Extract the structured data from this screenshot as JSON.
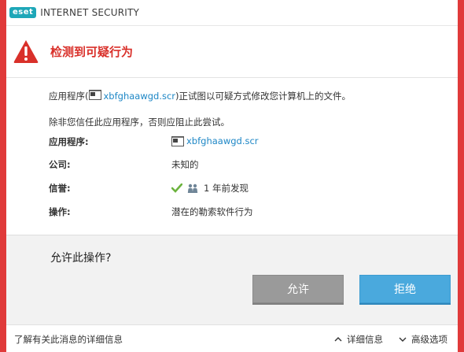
{
  "titlebar": {
    "logo": "eset",
    "product": "INTERNET SECURITY"
  },
  "alert": {
    "title": "检测到可疑行为",
    "icon": "warning-icon"
  },
  "message": {
    "line1_prefix": "应用程序(",
    "filename": "xbfghaawgd.scr",
    "line1_suffix": ")正试图以可疑方式修改您计算机上的文件。",
    "line2": "除非您信任此应用程序，否则应阻止此尝试。"
  },
  "details": {
    "app_label": "应用程序:",
    "app_value": "xbfghaawgd.scr",
    "company_label": "公司:",
    "company_value": "未知的",
    "reputation_label": "信誉:",
    "reputation_value": "1 年前发现",
    "operation_label": "操作:",
    "operation_value": "潜在的勒索软件行为"
  },
  "prompt": {
    "question": "允许此操作?",
    "allow_label": "允许",
    "deny_label": "拒绝"
  },
  "footer": {
    "learn_more": "了解有关此消息的详细信息",
    "details_label": "详细信息",
    "advanced_label": "高级选项"
  },
  "colors": {
    "accent_red": "#d9302a",
    "link_blue": "#1e87c6",
    "deny_blue": "#4aa9dd"
  }
}
